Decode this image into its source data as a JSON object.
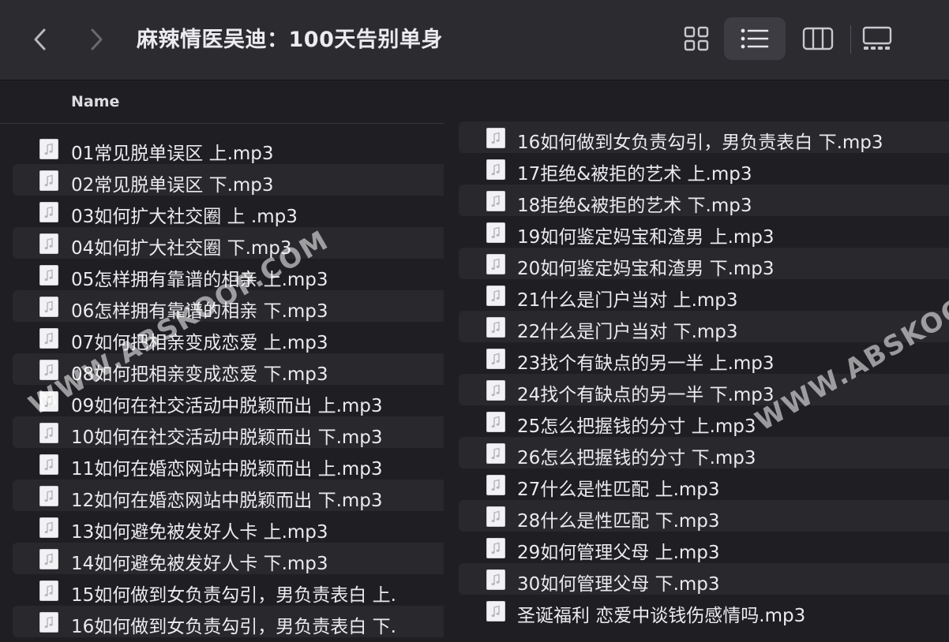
{
  "window": {
    "title": "麻辣情医吴迪：100天告别单身"
  },
  "toolbar": {
    "back_icon": "chevron-left-icon",
    "forward_icon": "chevron-right-icon",
    "view_icons": [
      "grid-view-icon",
      "list-view-icon",
      "column-view-icon",
      "gallery-view-icon"
    ],
    "active_view": "list-view-icon"
  },
  "columns": {
    "name": "Name"
  },
  "watermark": {
    "text": "WWW.ABSKOOP.COM"
  },
  "left_files": [
    "01常见脱单误区 上.mp3",
    "02常见脱单误区 下.mp3",
    "03如何扩大社交圈 上 .mp3",
    "04如何扩大社交圈 下.mp3",
    "05怎样拥有靠谱的相亲 上.mp3",
    "06怎样拥有靠谱的相亲 下.mp3",
    "07如何把相亲变成恋爱 上.mp3",
    "08如何把相亲变成恋爱 下.mp3",
    "09如何在社交活动中脱颖而出 上.mp3",
    "10如何在社交活动中脱颖而出 下.mp3",
    "11如何在婚恋网站中脱颖而出 上.mp3",
    "12如何在婚恋网站中脱颖而出 下.mp3",
    "13如何避免被发好人卡 上.mp3",
    "14如何避免被发好人卡 下.mp3",
    "15如何做到女负责勾引，男负责表白 上.",
    "16如何做到女负责勾引，男负责表白 下."
  ],
  "right_files": [
    "16如何做到女负责勾引，男负责表白 下.mp3",
    "17拒绝&被拒的艺术 上.mp3",
    "18拒绝&被拒的艺术 下.mp3",
    "19如何鉴定妈宝和渣男 上.mp3",
    "20如何鉴定妈宝和渣男 下.mp3",
    "21什么是门户当对 上.mp3",
    "22什么是门户当对 下.mp3",
    "23找个有缺点的另一半 上.mp3",
    "24找个有缺点的另一半 下.mp3",
    "25怎么把握钱的分寸 上.mp3",
    "26怎么把握钱的分寸 下.mp3",
    "27什么是性匹配 上.mp3",
    "28什么是性匹配 下.mp3",
    "29如何管理父母 上.mp3",
    "30如何管理父母 下.mp3",
    "圣诞福利 恋爱中谈钱伤感情吗.mp3"
  ],
  "colors": {
    "toolbar_bg": "#2c2b30",
    "list_bg": "#1f1e23",
    "alt_row_bg": "#29282d",
    "active_view_bg": "#3d3c42",
    "text": "#ebebee"
  }
}
